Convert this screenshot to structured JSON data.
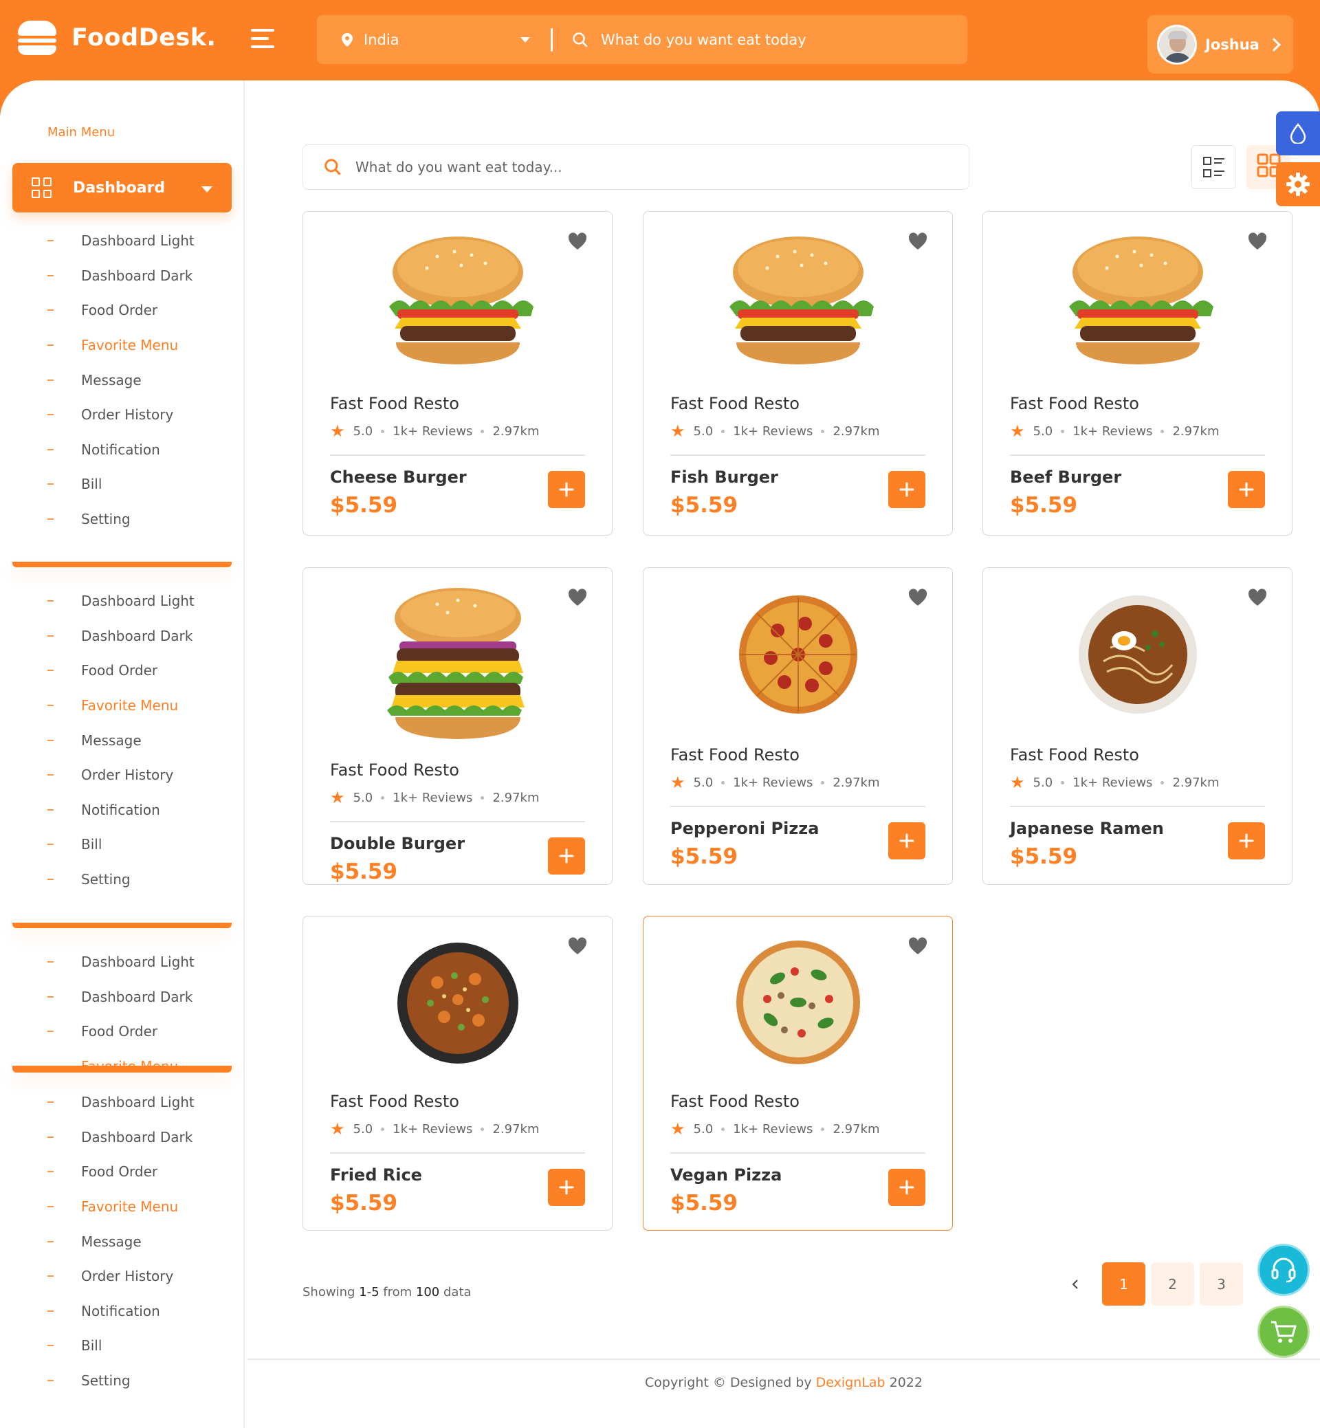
{
  "brand": {
    "name": "FoodDesk."
  },
  "header": {
    "location": "India",
    "search_placeholder": "What do you want eat today",
    "user_name": "Joshua"
  },
  "sidebar": {
    "section_label": "Main Menu",
    "dashboard_label": "Dashboard",
    "groups": [
      {
        "items": [
          "Dashboard Light",
          "Dashboard Dark",
          "Food Order",
          "Favorite Menu",
          "Message",
          "Order History",
          "Notification",
          "Bill",
          "Setting"
        ]
      },
      {
        "items": [
          "Dashboard Light",
          "Dashboard Dark",
          "Food Order",
          "Favorite Menu",
          "Message",
          "Order History",
          "Notification",
          "Bill",
          "Setting"
        ]
      },
      {
        "items": [
          "Dashboard Light",
          "Dashboard Dark",
          "Food Order",
          "Favorite Menu"
        ]
      },
      {
        "items": [
          "Dashboard Light",
          "Dashboard Dark",
          "Food Order",
          "Favorite Menu",
          "Message",
          "Order History",
          "Notification",
          "Bill",
          "Setting"
        ]
      }
    ],
    "active_item": "Favorite Menu"
  },
  "main": {
    "search_placeholder": "What do you want eat today...",
    "cards": [
      {
        "resto": "Fast Food Resto",
        "rating": "5.0",
        "reviews": "1k+ Reviews",
        "distance": "2.97km",
        "name": "Cheese Burger",
        "price": "$5.59",
        "image": "burger"
      },
      {
        "resto": "Fast Food Resto",
        "rating": "5.0",
        "reviews": "1k+ Reviews",
        "distance": "2.97km",
        "name": "Fish Burger",
        "price": "$5.59",
        "image": "burger"
      },
      {
        "resto": "Fast Food Resto",
        "rating": "5.0",
        "reviews": "1k+ Reviews",
        "distance": "2.97km",
        "name": "Beef Burger",
        "price": "$5.59",
        "image": "burger"
      },
      {
        "resto": "Fast Food Resto",
        "rating": "5.0",
        "reviews": "1k+ Reviews",
        "distance": "2.97km",
        "name": "Double Burger",
        "price": "$5.59",
        "image": "double-burger"
      },
      {
        "resto": "Fast Food Resto",
        "rating": "5.0",
        "reviews": "1k+ Reviews",
        "distance": "2.97km",
        "name": "Pepperoni Pizza",
        "price": "$5.59",
        "image": "pizza"
      },
      {
        "resto": "Fast Food Resto",
        "rating": "5.0",
        "reviews": "1k+ Reviews",
        "distance": "2.97km",
        "name": "Japanese Ramen",
        "price": "$5.59",
        "image": "ramen"
      },
      {
        "resto": "Fast Food Resto",
        "rating": "5.0",
        "reviews": "1k+ Reviews",
        "distance": "2.97km",
        "name": "Fried Rice",
        "price": "$5.59",
        "image": "fried-rice"
      },
      {
        "resto": "Fast Food Resto",
        "rating": "5.0",
        "reviews": "1k+ Reviews",
        "distance": "2.97km",
        "name": "Vegan Pizza",
        "price": "$5.59",
        "image": "vegan-pizza"
      }
    ],
    "showing": {
      "prefix": "Showing",
      "range": "1-5",
      "from": "from",
      "total": "100",
      "suffix": "data"
    },
    "pagination": [
      "1",
      "2",
      "3"
    ],
    "current_page": "1"
  },
  "footer": {
    "prefix": "Copyright © Designed by",
    "brand": "DexignLab",
    "year": "2022"
  },
  "colors": {
    "accent": "#fe8024",
    "accent_light": "#fe973f",
    "support": "#1ab9d8",
    "cart": "#6fbf44",
    "theme": "#3a66dd"
  }
}
